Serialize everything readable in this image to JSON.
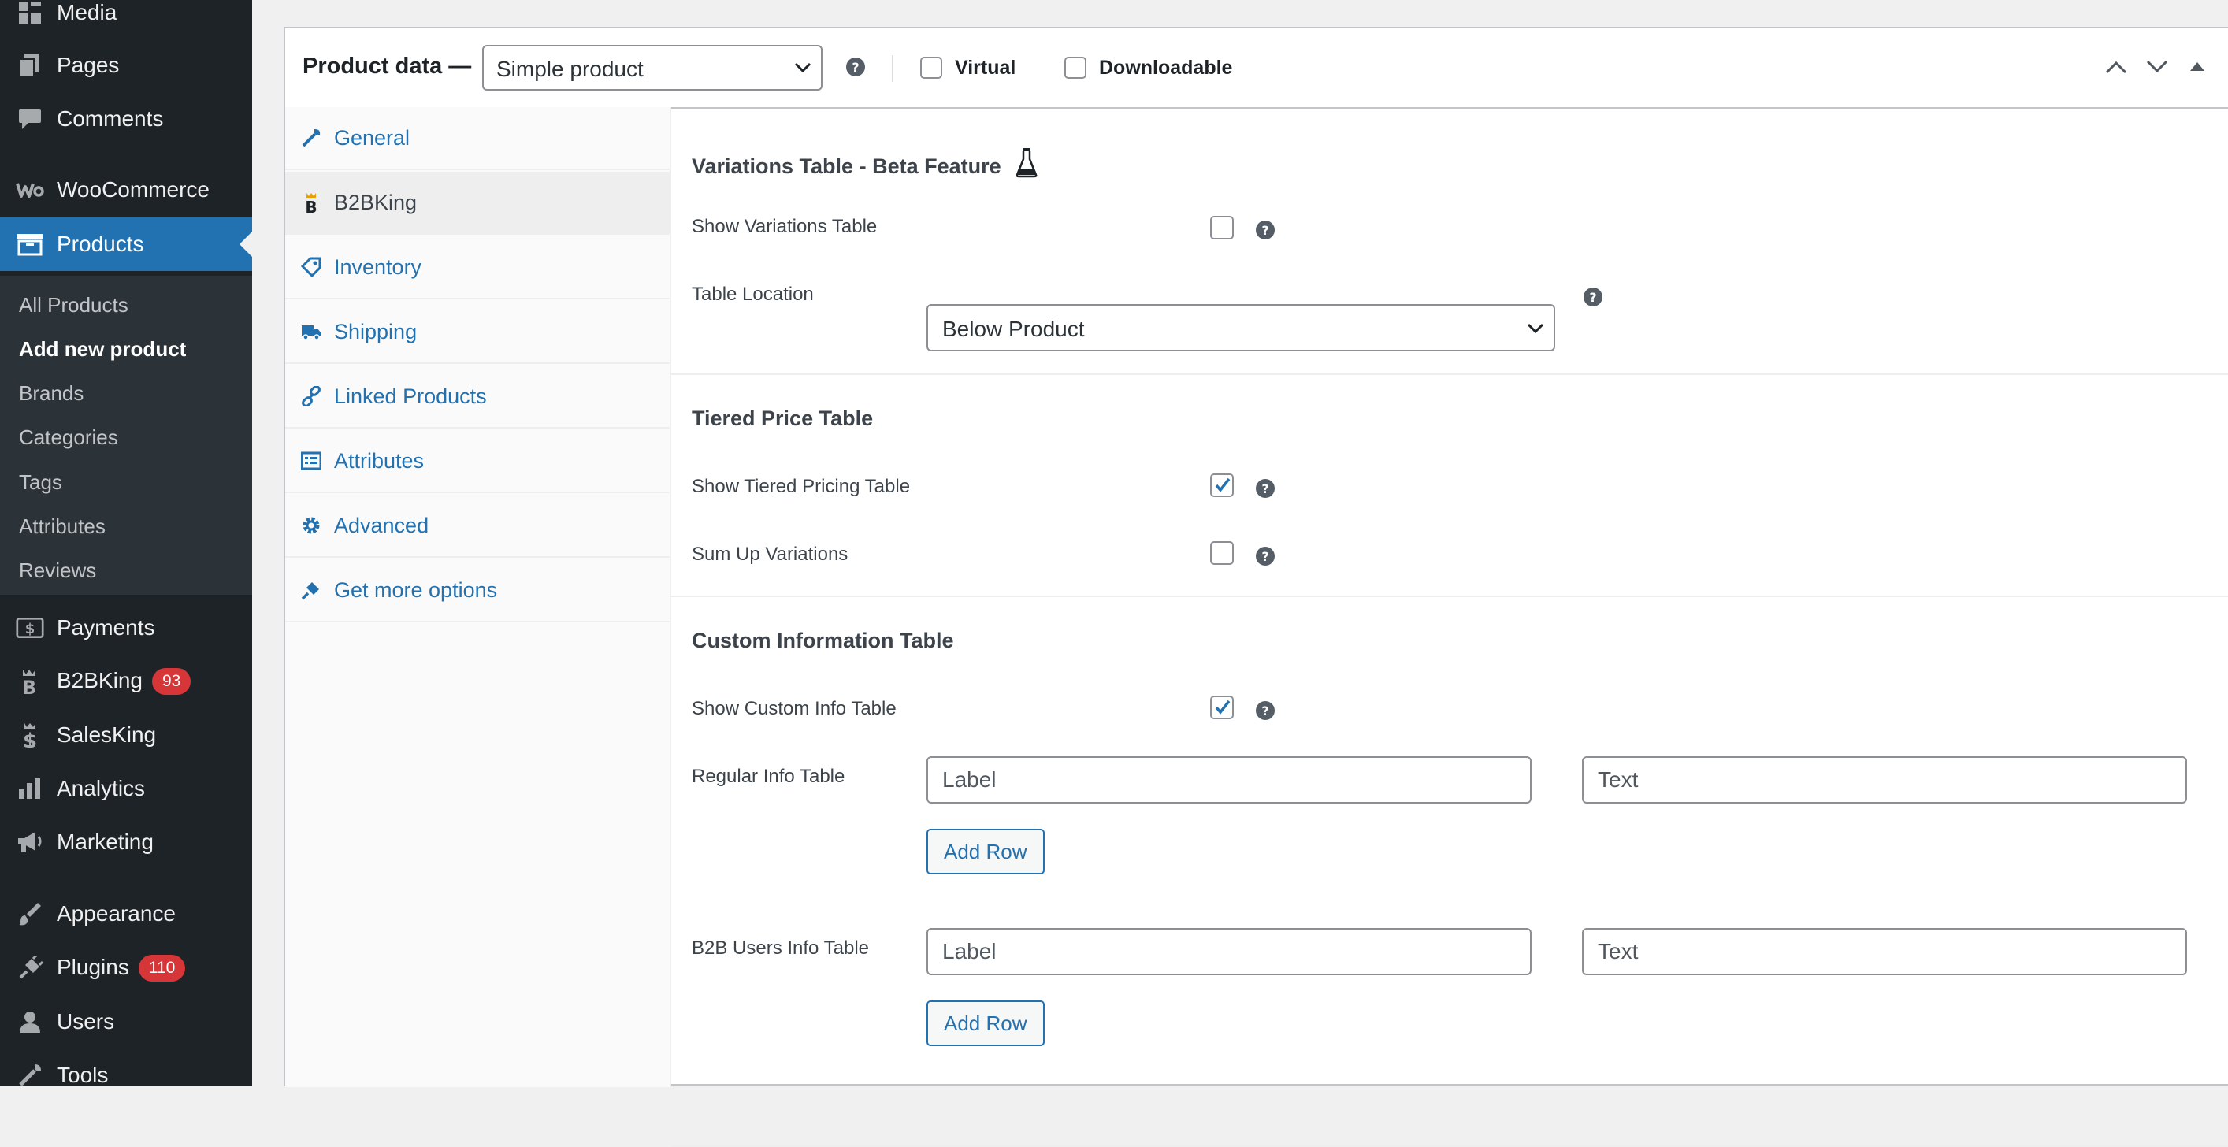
{
  "sidebar": {
    "items": [
      {
        "key": "media",
        "label": "Media",
        "icon": "media-icon"
      },
      {
        "key": "pages",
        "label": "Pages",
        "icon": "pages-icon"
      },
      {
        "key": "comments",
        "label": "Comments",
        "icon": "comments-icon"
      },
      {
        "key": "woocommerce",
        "label": "WooCommerce",
        "icon": "woocommerce-icon"
      },
      {
        "key": "products",
        "label": "Products",
        "icon": "products-icon",
        "active": true
      },
      {
        "key": "payments",
        "label": "Payments",
        "icon": "payments-icon"
      },
      {
        "key": "b2bking",
        "label": "B2BKing",
        "icon": "b2bking-icon",
        "badge": "93"
      },
      {
        "key": "salesking",
        "label": "SalesKing",
        "icon": "salesking-icon"
      },
      {
        "key": "analytics",
        "label": "Analytics",
        "icon": "analytics-icon"
      },
      {
        "key": "marketing",
        "label": "Marketing",
        "icon": "marketing-icon"
      },
      {
        "key": "appearance",
        "label": "Appearance",
        "icon": "appearance-icon"
      },
      {
        "key": "plugins",
        "label": "Plugins",
        "icon": "plugins-icon",
        "badge": "110"
      },
      {
        "key": "users",
        "label": "Users",
        "icon": "users-icon"
      },
      {
        "key": "tools",
        "label": "Tools",
        "icon": "tools-icon"
      }
    ],
    "submenu": [
      "All Products",
      "Add new product",
      "Brands",
      "Categories",
      "Tags",
      "Attributes",
      "Reviews"
    ],
    "submenu_current": "Add new product"
  },
  "product_data": {
    "title": "Product data —",
    "type_value": "Simple product",
    "virtual_label": "Virtual",
    "downloadable_label": "Downloadable",
    "virtual_checked": false,
    "downloadable_checked": false
  },
  "tabs": [
    {
      "label": "General",
      "icon": "wrench-icon"
    },
    {
      "label": "B2BKing",
      "icon": "b2bking-icon",
      "active": true
    },
    {
      "label": "Inventory",
      "icon": "tag-icon"
    },
    {
      "label": "Shipping",
      "icon": "truck-icon"
    },
    {
      "label": "Linked Products",
      "icon": "link-icon"
    },
    {
      "label": "Attributes",
      "icon": "list-icon"
    },
    {
      "label": "Advanced",
      "icon": "gear-icon"
    },
    {
      "label": "Get more options",
      "icon": "plugin-icon"
    }
  ],
  "panel": {
    "variations": {
      "title": "Variations Table - Beta Feature",
      "title_icon": "flask-icon",
      "show_label": "Show Variations Table",
      "show_checked": false,
      "location_label": "Table Location",
      "location_value": "Below Product"
    },
    "tiered": {
      "title": "Tiered Price Table",
      "show_label": "Show Tiered Pricing Table",
      "show_checked": true,
      "sum_label": "Sum Up Variations",
      "sum_checked": false
    },
    "custom": {
      "title": "Custom Information Table",
      "show_label": "Show Custom Info Table",
      "show_checked": true,
      "regular_label": "Regular Info Table",
      "b2b_label": "B2B Users Info Table",
      "label_placeholder": "Label",
      "text_placeholder": "Text",
      "add_row_label": "Add Row"
    }
  },
  "colors": {
    "accent": "#2271b1",
    "sidebar_bg": "#1d2327",
    "badge": "#d63638"
  }
}
